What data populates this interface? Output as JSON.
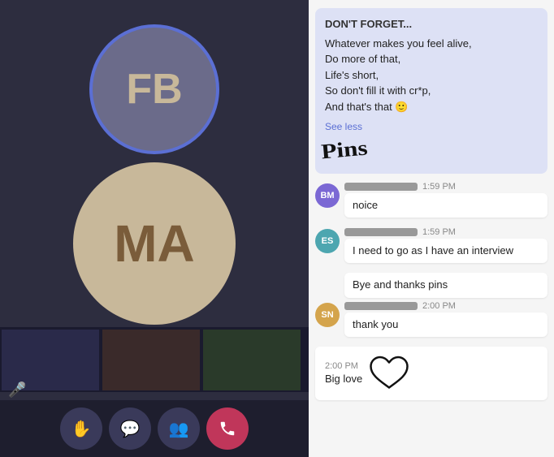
{
  "left": {
    "avatar_fb_initials": "FB",
    "avatar_ma_initials": "MA"
  },
  "toolbar": {
    "hand_label": "✋",
    "chat_label": "💬",
    "people_label": "👥",
    "end_call_label": "📞"
  },
  "chat": {
    "pinned": {
      "header": "DON'T FORGET...",
      "line1": "Whatever makes you feel alive,",
      "line2": "Do more of that,",
      "line3": "Life's short,",
      "line4": "So don't fill it with cr*p,",
      "line5": "And that's that 🙂",
      "see_less": "See less",
      "signature": "Pins"
    },
    "messages": [
      {
        "avatar": "BM",
        "avatar_class": "avatar-bm",
        "name_redacted": true,
        "time": "1:59 PM",
        "text": "noice"
      },
      {
        "avatar": "ES",
        "avatar_class": "avatar-es",
        "name_redacted": true,
        "time": "1:59 PM",
        "text": "I need to go as I have an interview"
      },
      {
        "avatar": null,
        "text": "Bye and thanks pins",
        "no_avatar": true
      },
      {
        "avatar": "SN",
        "avatar_class": "avatar-sn",
        "name_redacted": true,
        "time": "2:00 PM",
        "text": "thank you"
      },
      {
        "avatar": null,
        "time": "2:00 PM",
        "text": "Big love",
        "has_heart": true,
        "no_avatar": true
      }
    ]
  }
}
